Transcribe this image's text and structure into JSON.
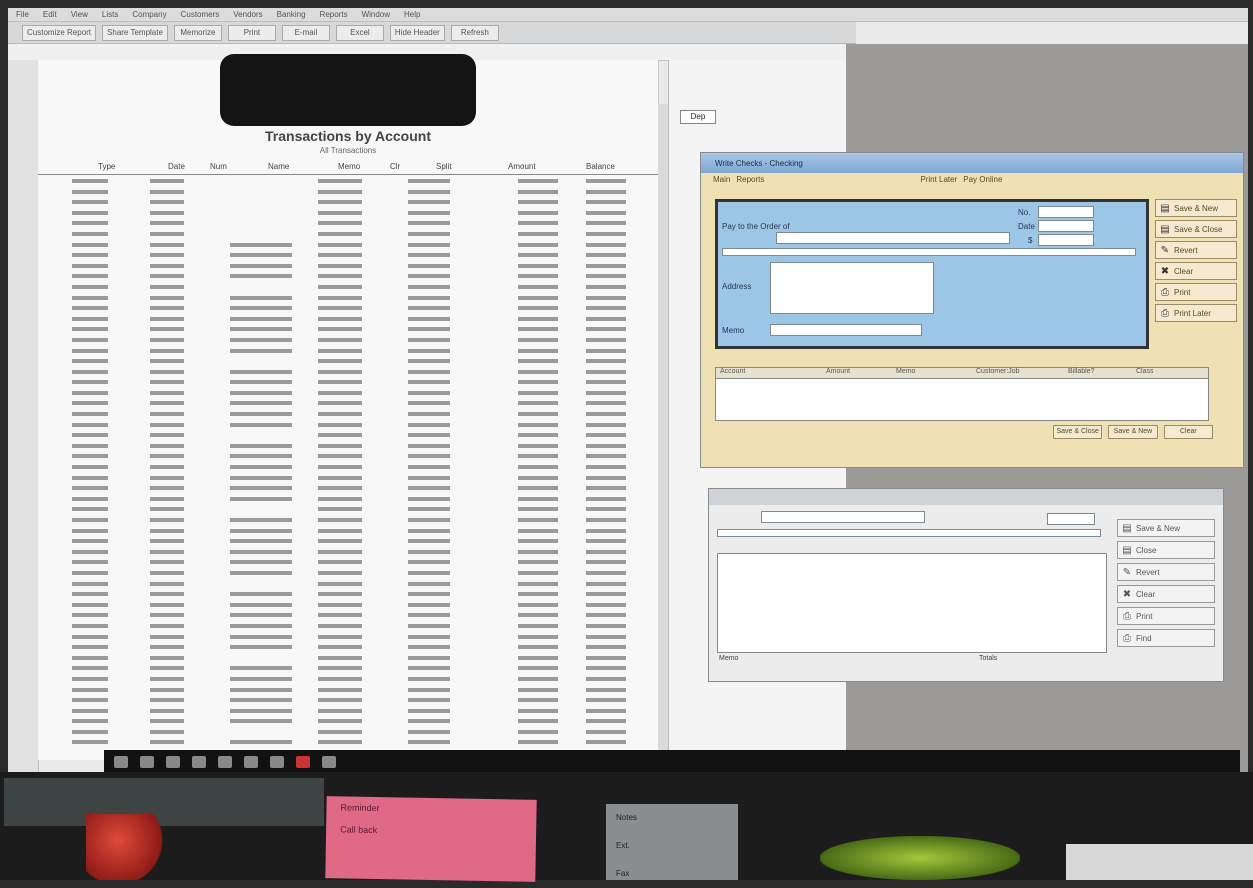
{
  "menubar": {
    "items": [
      "File",
      "Edit",
      "View",
      "Lists",
      "Company",
      "Customers",
      "Vendors",
      "Banking",
      "Reports",
      "Window",
      "Help"
    ]
  },
  "toolbar": {
    "buttons": [
      "Customize Report",
      "Share Template",
      "Memorize",
      "Print",
      "E-mail",
      "Excel",
      "Hide Header",
      "Refresh"
    ]
  },
  "report": {
    "title": "Transactions by Account",
    "subtitle": "All Transactions",
    "columns": [
      "Type",
      "Date",
      "Num",
      "Name",
      "Memo",
      "Clr",
      "Split",
      "Amount",
      "Balance"
    ],
    "rows": [
      {
        "type": "",
        "date": "",
        "name": "",
        "memo": "",
        "split": "",
        "amt": "",
        "bal": ""
      }
    ]
  },
  "mid": {
    "label": "Dep"
  },
  "checkwin": {
    "title": "Write Checks - Checking",
    "tabs": [
      "Main",
      "Reports",
      "Print Later",
      "Pay Online"
    ],
    "pay_to_label": "Pay to the Order of",
    "address_label": "Address",
    "memo_label": "Memo",
    "no_label": "No.",
    "date_label": "Date",
    "amount_symbol": "$",
    "side_buttons": [
      "Save & New",
      "Save & Close",
      "Revert",
      "Clear",
      "Print",
      "Print Later"
    ],
    "split_columns": [
      "Account",
      "Amount",
      "Memo",
      "Customer:Job",
      "Billable?",
      "Class"
    ],
    "footer_buttons": [
      "Save & Close",
      "Save & New",
      "Clear"
    ]
  },
  "win2": {
    "side_buttons": [
      "Save & New",
      "Close",
      "Revert",
      "Clear",
      "Print",
      "Find"
    ],
    "footer_left": "Memo",
    "footer_mid": "Totals"
  },
  "desk": {
    "pink_note": [
      "Reminder",
      "Call back"
    ],
    "grey_note": [
      "Notes",
      "Ext.",
      "Fax"
    ]
  }
}
